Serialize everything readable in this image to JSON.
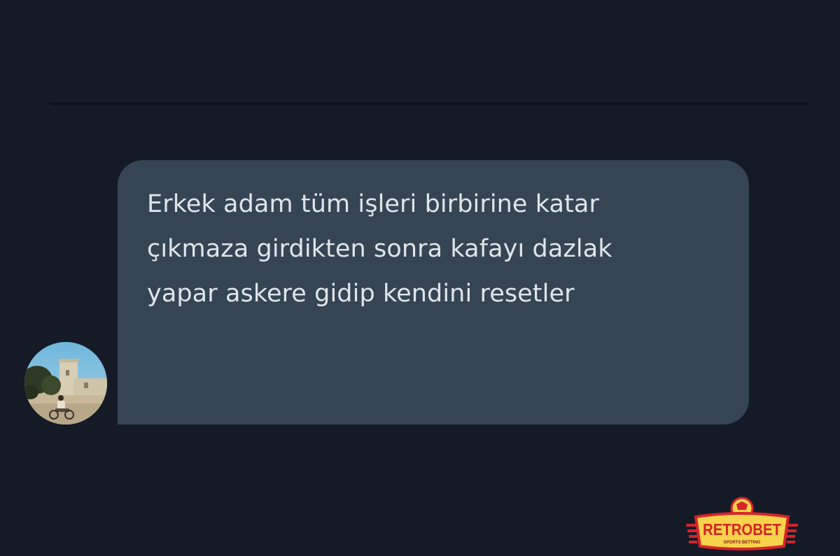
{
  "message": {
    "lines": [
      "Erkek adam tüm işleri birbirine katar",
      "çıkmaza girdikten sonra kafayı dazlak",
      "yapar askere gidip kendini resetler"
    ]
  },
  "watermark": {
    "brand": "RETROBET",
    "tagline": "SPORTS BETTING"
  },
  "colors": {
    "background": "#141b26",
    "bubble": "#354554",
    "message_text": "#dfe5ea",
    "logo_red": "#d8232a",
    "logo_yellow": "#f6d34a"
  },
  "icons": {
    "avatar": "user-avatar-photo",
    "watermark": "retrobet-logo"
  }
}
